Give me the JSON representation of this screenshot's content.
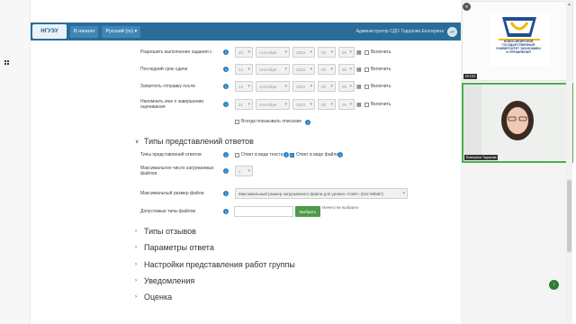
{
  "header": {
    "home_label": "В начало",
    "language_label": "Русский (ru) ▾",
    "user_text": "Администратор СДО Тодорова Екатерина",
    "avatar_initials": "АТ"
  },
  "dates": {
    "rows": [
      {
        "label": "Разрешить выполнение задания с",
        "day": "10",
        "month": "сентября",
        "year": "2023",
        "hour": "00",
        "min": "00",
        "enable": "Включить"
      },
      {
        "label": "Последний срок сдачи",
        "day": "14",
        "month": "сентября",
        "year": "2023",
        "hour": "00",
        "min": "00",
        "enable": "Включить"
      },
      {
        "label": "Запретить отправку после",
        "day": "14",
        "month": "сентября",
        "year": "2023",
        "hour": "00",
        "min": "00",
        "enable": "Включить"
      },
      {
        "label": "Напомнить мне о завершении оценивания",
        "day": "21",
        "month": "сентября",
        "year": "2023",
        "hour": "00",
        "min": "00",
        "enable": "Включить"
      }
    ],
    "always_show": "Всегда показывать описание"
  },
  "submission_types": {
    "title": "Типы представлений ответов",
    "types_label": "Типы представлений ответов",
    "text_option": "Ответ в виде текста",
    "file_option": "Ответ в виде файла",
    "max_files_label": "Максимальное число загружаемых файлов",
    "max_files_value": "1",
    "max_size_label": "Максимальный размер файла",
    "max_size_value": "Максимальный размер загружаемого файла для уровня «Сайт» (512 Мбайт)",
    "accepted_label": "Допустимые типы файлов",
    "choose_button": "Выбрать",
    "nothing_selected": "Ничего не выбрано"
  },
  "sections": [
    "Типы отзывов",
    "Параметры ответа",
    "Настройки представления работ группы",
    "Уведомления",
    "Оценка"
  ],
  "participants": {
    "tile1_name": "НГУЭУ",
    "tile1_logo_text": "НОВОСИБИРСКИЙ ГОСУДАРСТВЕННЫЙ УНИВЕРСИТЕТ ЭКОНОМИКИ И УПРАВЛЕНИЯ",
    "tile1_logo_abbr": "НГУЭУ",
    "tile2_name": "Екатерина Тодорова"
  },
  "colors": {
    "header": "#2a6d9a",
    "active_speaker": "#4caf50",
    "primary_button": "#4e9a4e",
    "help_icon": "#2a82c0"
  }
}
